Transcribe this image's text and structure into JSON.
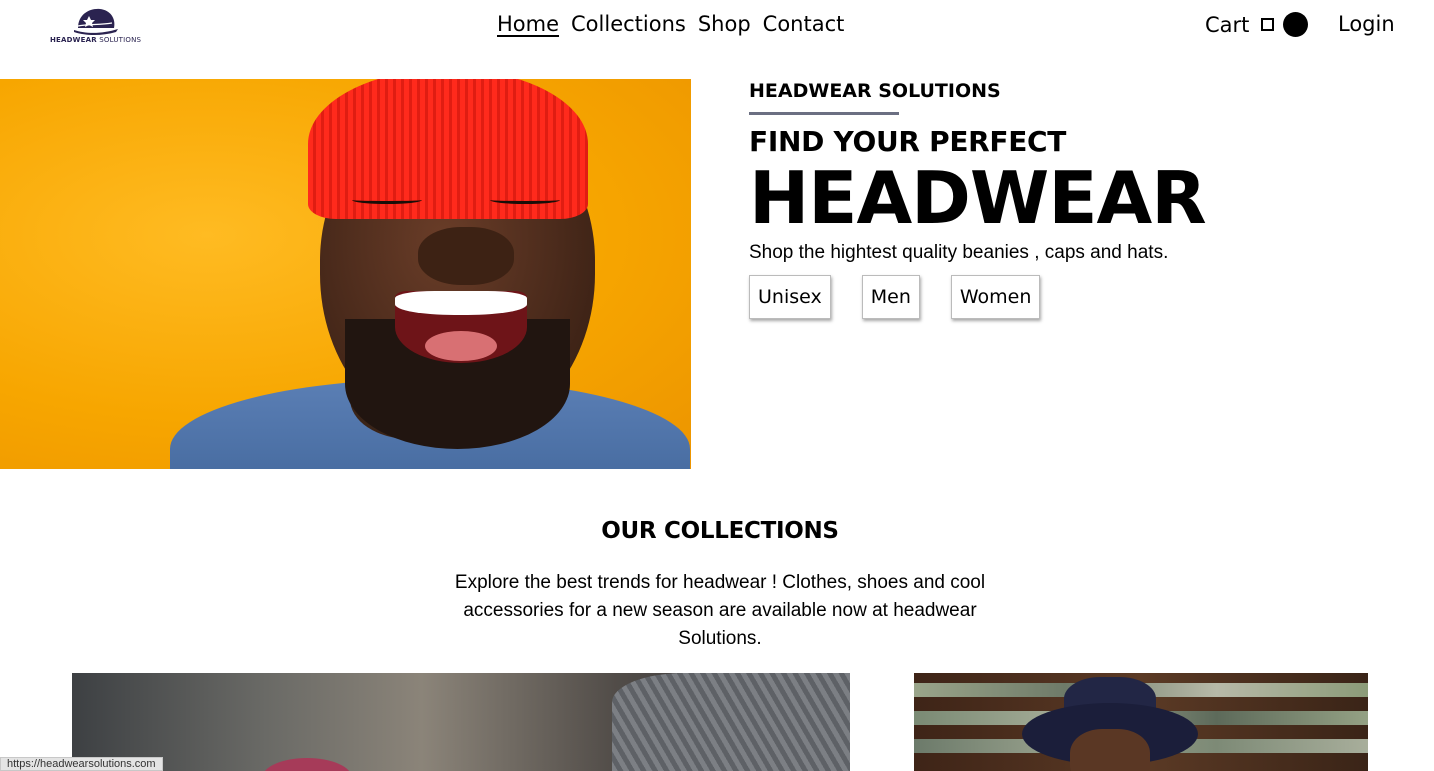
{
  "brand": {
    "logo_bold": "HEADWEAR",
    "logo_light": "SOLUTIONS"
  },
  "nav": {
    "items": [
      {
        "label": "Home",
        "active": true
      },
      {
        "label": "Collections",
        "active": false
      },
      {
        "label": "Shop",
        "active": false
      },
      {
        "label": "Contact",
        "active": false
      }
    ]
  },
  "header": {
    "cart_label": "Cart",
    "login_label": "Login"
  },
  "hero": {
    "brand": "HEADWEAR SOLUTIONS",
    "kicker": "FIND YOUR PERFECT",
    "headline": "HEADWEAR",
    "tagline": "Shop the hightest quality beanies , caps and hats.",
    "filters": [
      "Unisex",
      "Men",
      "Women"
    ]
  },
  "collections": {
    "title": "OUR COLLECTIONS",
    "description": "Explore the best trends for headwear ! Clothes, shoes and cool accessories for a new season are available now at headwear Solutions."
  },
  "status_bar": {
    "url": "https://headwearsolutions.com"
  },
  "colors": {
    "accent_rule": "#6b6f82",
    "hero_bg": "#f7a600",
    "beanie": "#ff2a1c"
  }
}
